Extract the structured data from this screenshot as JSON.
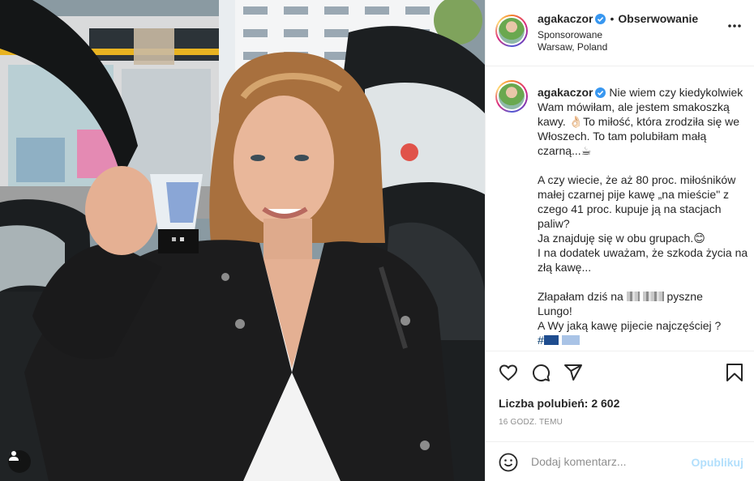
{
  "post": {
    "username": "agakaczor",
    "follow_label": "Obserwowanie",
    "separator": "•",
    "sponsored_label": "Sponsorowane",
    "location": "Warsaw, Poland"
  },
  "caption": {
    "username": "agakaczor",
    "paragraph1": [
      "Nie wiem czy kiedykolwiek",
      "Wam mówiłam, ale jestem smakoszką",
      "kawy. 👌🏻To miłość, która zrodziła się we",
      "Włoszech. To tam polubiłam małą",
      "czarną...☕"
    ],
    "paragraph2": [
      "A czy wiecie, że aż 80 proc. miłośników",
      "małej czarnej pije kawę „na mieście\" z",
      "czego 41 proc. kupuje ją na stacjach",
      "paliw?",
      "Ja znajduję się w obu grupach.😊",
      "I na dodatek uważam, że szkoda życia na",
      "złą kawę..."
    ],
    "paragraph3_before": "Złapałam dziś na",
    "paragraph3_after": "pyszne",
    "paragraph3_line2": "Lungo!",
    "paragraph3_line3": "A Wy jaką kawę pijecie najczęściej ?",
    "hashtag_prefix": "#"
  },
  "stats": {
    "likes": "Liczba polubień: 2 602",
    "time": "16 GODZ. TEMU"
  },
  "comment": {
    "placeholder": "Dodaj komentarz...",
    "publish_label": "Opublikuj"
  },
  "icons": [
    "verified-badge-icon",
    "more-options-icon",
    "heart-icon",
    "comment-icon",
    "share-icon",
    "bookmark-icon",
    "emoji-icon",
    "user-tag-icon"
  ],
  "colors": {
    "verified": "#3897f0",
    "publish": "#b2dffc",
    "link": "#00376b",
    "muted": "#8e8e8e"
  }
}
